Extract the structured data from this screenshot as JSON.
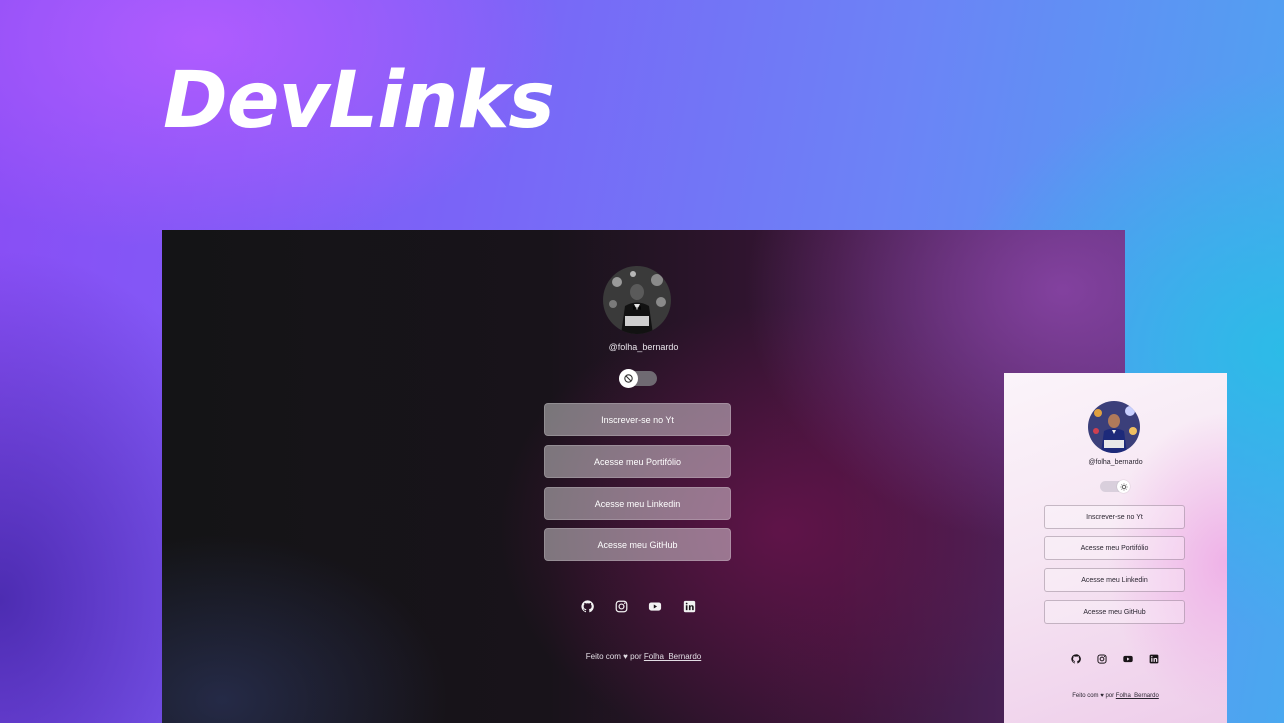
{
  "brand": {
    "title": "DevLinks"
  },
  "profile": {
    "handle": "@folha_bernardo",
    "avatar_icon": "profile-photo"
  },
  "links": [
    {
      "label": "Inscrever-se no Yt"
    },
    {
      "label": "Acesse meu Portifólio"
    },
    {
      "label": "Acesse meu Linkedin"
    },
    {
      "label": "Acesse meu GitHub"
    }
  ],
  "social_icons": [
    "github-icon",
    "instagram-icon",
    "youtube-icon",
    "linkedin-icon"
  ],
  "theme_toggle": {
    "dark_state_icon": "moon-icon",
    "light_state_icon": "sun-icon",
    "track_dark": "#6f6a72",
    "track_light": "#d9cfdc"
  },
  "footer": {
    "made_with": "Feito com",
    "heart": "♥",
    "by": "por",
    "author": "Folha_Bernardo"
  },
  "colors": {
    "bg_purple": "#8a4df5",
    "bg_blue": "#4aa8f0",
    "desk_bg": "#141416",
    "mobile_bg": "#fbf4fa"
  }
}
